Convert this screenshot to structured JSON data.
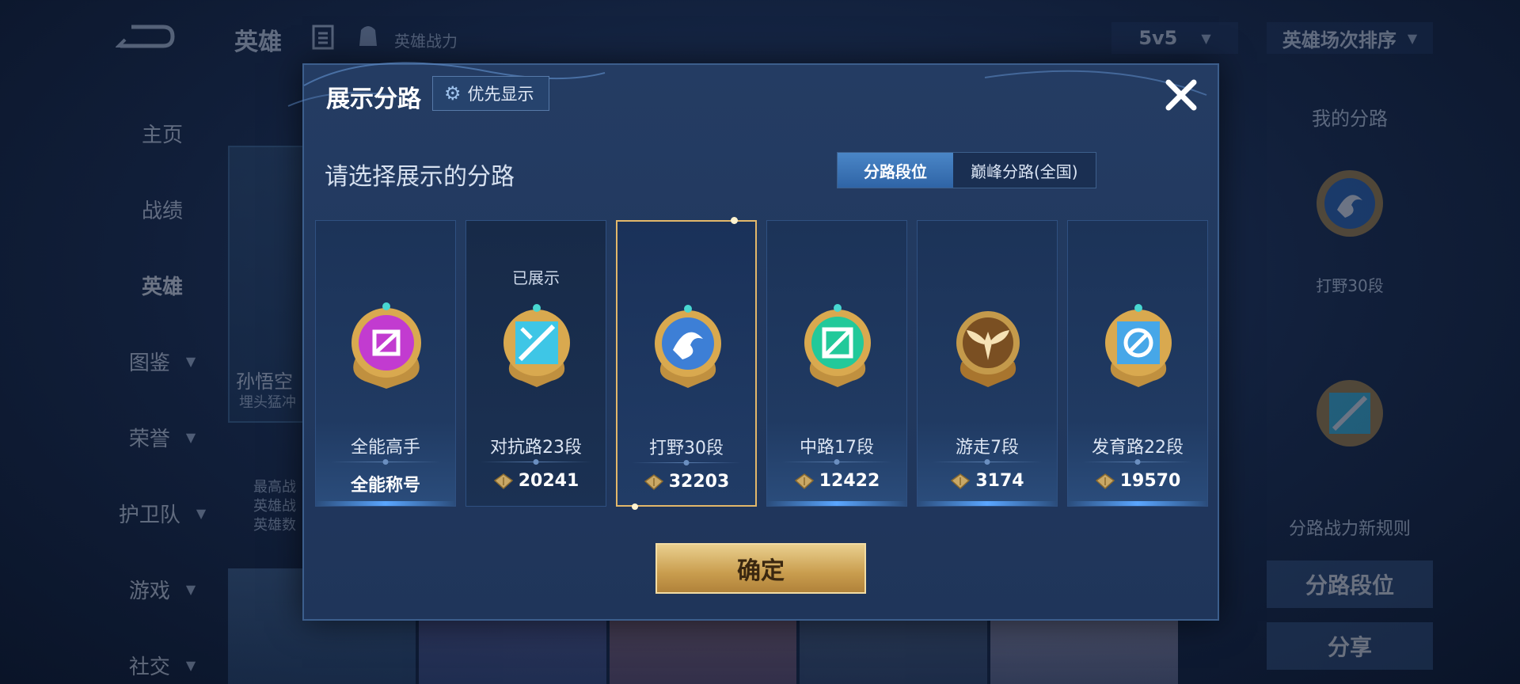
{
  "background": {
    "topbar": {
      "title": "英雄",
      "power_label": "英雄战力",
      "mode": "5v5",
      "sort": "英雄场次排序"
    },
    "nav": [
      {
        "label": "主页",
        "has_chevron": false
      },
      {
        "label": "战绩",
        "has_chevron": false
      },
      {
        "label": "英雄",
        "has_chevron": false,
        "active": true
      },
      {
        "label": "图鉴",
        "has_chevron": true
      },
      {
        "label": "荣誉",
        "has_chevron": true
      },
      {
        "label": "护卫队",
        "has_chevron": true
      },
      {
        "label": "游戏",
        "has_chevron": true
      },
      {
        "label": "社交",
        "has_chevron": true
      }
    ],
    "hero_card": {
      "name": "孙悟空",
      "subtitle": "埋头猛冲",
      "desc": "最高战 英雄战 英雄数"
    },
    "right_panel": {
      "my_lane_title": "我的分路",
      "rank_text": "打野30段",
      "new_rules": "分路战力新规则",
      "lane_rank_button": "分路段位",
      "share_button": "分享"
    }
  },
  "modal": {
    "title": "展示分路",
    "priority_button": "优先显示",
    "prompt": "请选择展示的分路",
    "toggle": {
      "active": "分路段位",
      "inactive": "巅峰分路(全国)"
    },
    "lanes": [
      {
        "status": "",
        "label": "全能高手",
        "bottom_text": "全能称号",
        "power": "",
        "badge": "allround",
        "color": "#c23bd0"
      },
      {
        "status": "已展示",
        "label": "对抗路23段",
        "bottom_text": "",
        "power": "20241",
        "badge": "clash",
        "color": "#3ec6e6"
      },
      {
        "status": "",
        "label": "打野30段",
        "bottom_text": "",
        "power": "32203",
        "badge": "jungle",
        "color": "#3d7fd6",
        "selected": true
      },
      {
        "status": "",
        "label": "中路17段",
        "bottom_text": "",
        "power": "12422",
        "badge": "mid",
        "color": "#22c99a"
      },
      {
        "status": "",
        "label": "游走7段",
        "bottom_text": "",
        "power": "3174",
        "badge": "roam",
        "color": "#c49a4b"
      },
      {
        "status": "",
        "label": "发育路22段",
        "bottom_text": "",
        "power": "19570",
        "badge": "farm",
        "color": "#46a7e8"
      }
    ],
    "confirm_button": "确定"
  }
}
